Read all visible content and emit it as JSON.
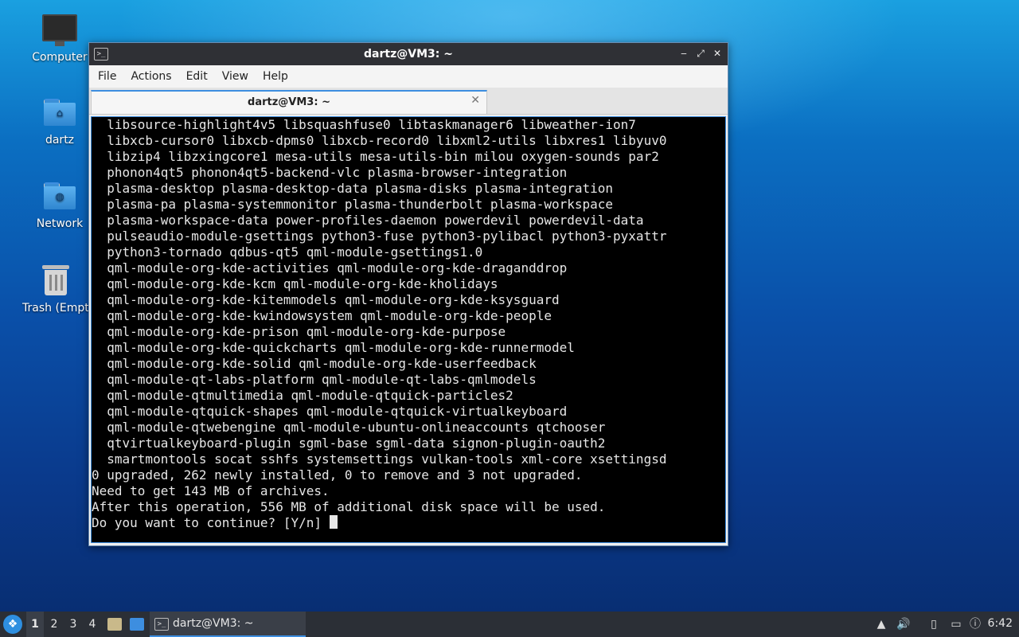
{
  "desktop": {
    "icons": [
      {
        "label": "Computer"
      },
      {
        "label": "dartz"
      },
      {
        "label": "Network"
      },
      {
        "label": "Trash (Empt"
      }
    ]
  },
  "window": {
    "title": "dartz@VM3: ~",
    "icon": "terminal-icon",
    "controls": {
      "minimize": "‒",
      "maximize": "⤢",
      "close": "✕"
    }
  },
  "menu": {
    "items": [
      "File",
      "Actions",
      "Edit",
      "View",
      "Help"
    ]
  },
  "tab": {
    "label": "dartz@VM3: ~",
    "close": "✕"
  },
  "terminal": {
    "lines": [
      "  libsource-highlight4v5 libsquashfuse0 libtaskmanager6 libweather-ion7",
      "  libxcb-cursor0 libxcb-dpms0 libxcb-record0 libxml2-utils libxres1 libyuv0",
      "  libzip4 libzxingcore1 mesa-utils mesa-utils-bin milou oxygen-sounds par2",
      "  phonon4qt5 phonon4qt5-backend-vlc plasma-browser-integration",
      "  plasma-desktop plasma-desktop-data plasma-disks plasma-integration",
      "  plasma-pa plasma-systemmonitor plasma-thunderbolt plasma-workspace",
      "  plasma-workspace-data power-profiles-daemon powerdevil powerdevil-data",
      "  pulseaudio-module-gsettings python3-fuse python3-pylibacl python3-pyxattr",
      "  python3-tornado qdbus-qt5 qml-module-gsettings1.0",
      "  qml-module-org-kde-activities qml-module-org-kde-draganddrop",
      "  qml-module-org-kde-kcm qml-module-org-kde-kholidays",
      "  qml-module-org-kde-kitemmodels qml-module-org-kde-ksysguard",
      "  qml-module-org-kde-kwindowsystem qml-module-org-kde-people",
      "  qml-module-org-kde-prison qml-module-org-kde-purpose",
      "  qml-module-org-kde-quickcharts qml-module-org-kde-runnermodel",
      "  qml-module-org-kde-solid qml-module-org-kde-userfeedback",
      "  qml-module-qt-labs-platform qml-module-qt-labs-qmlmodels",
      "  qml-module-qtmultimedia qml-module-qtquick-particles2",
      "  qml-module-qtquick-shapes qml-module-qtquick-virtualkeyboard",
      "  qml-module-qtwebengine qml-module-ubuntu-onlineaccounts qtchooser",
      "  qtvirtualkeyboard-plugin sgml-base sgml-data signon-plugin-oauth2",
      "  smartmontools socat sshfs systemsettings vulkan-tools xml-core xsettingsd",
      "0 upgraded, 262 newly installed, 0 to remove and 3 not upgraded.",
      "Need to get 143 MB of archives.",
      "After this operation, 556 MB of additional disk space will be used."
    ],
    "prompt": "Do you want to continue? [Y/n] "
  },
  "taskbar": {
    "workspaces": [
      "1",
      "2",
      "3",
      "4"
    ],
    "active_workspace": "1",
    "task_label": "dartz@VM3: ~",
    "clock": "6:42"
  }
}
